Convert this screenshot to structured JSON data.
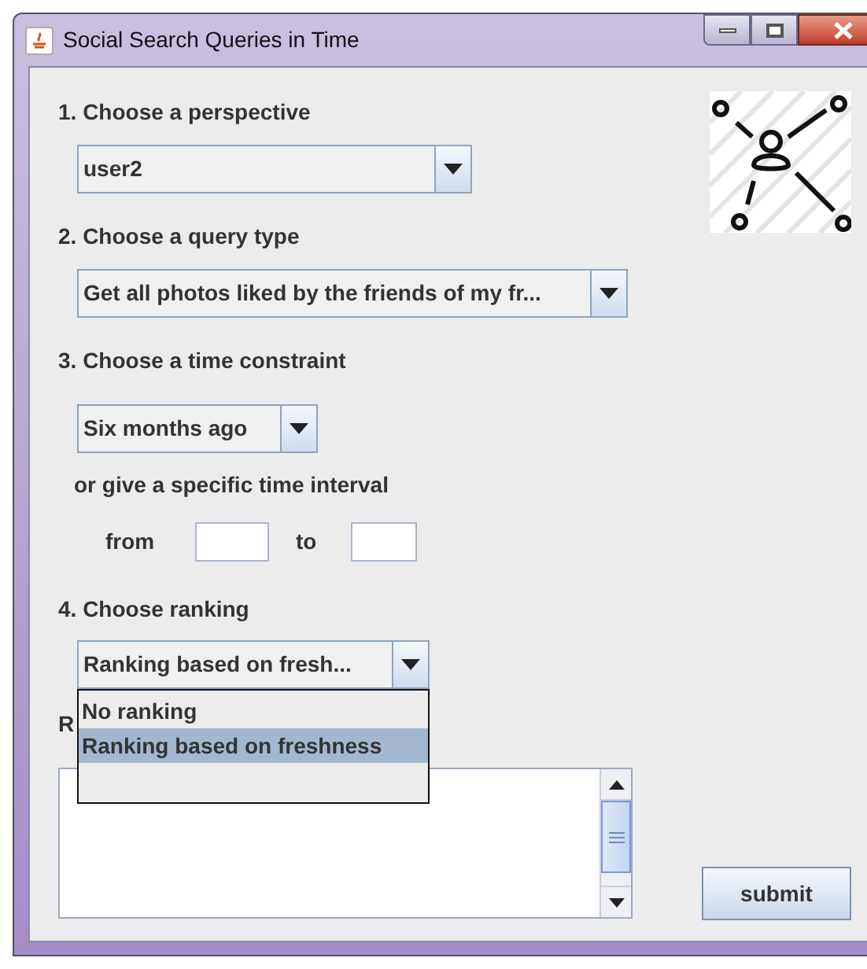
{
  "window": {
    "title": "Social Search Queries in Time"
  },
  "perspective": {
    "label": "1. Choose a perspective",
    "value": "user2"
  },
  "query_type": {
    "label": "2. Choose a query type",
    "value": "Get all photos liked by the friends of my fr..."
  },
  "time_constraint": {
    "label": "3. Choose a time constraint",
    "value": "Six months ago",
    "interval_label": "or give a specific time interval",
    "from_label": "from",
    "to_label": "to"
  },
  "ranking": {
    "label": "4. Choose ranking",
    "value": "Ranking based on fresh...",
    "expanded": true,
    "options": [
      {
        "label": "No ranking",
        "selected": false
      },
      {
        "label": "Ranking based on freshness",
        "selected": true
      }
    ]
  },
  "results": {
    "label": "R"
  },
  "submit": "submit"
}
